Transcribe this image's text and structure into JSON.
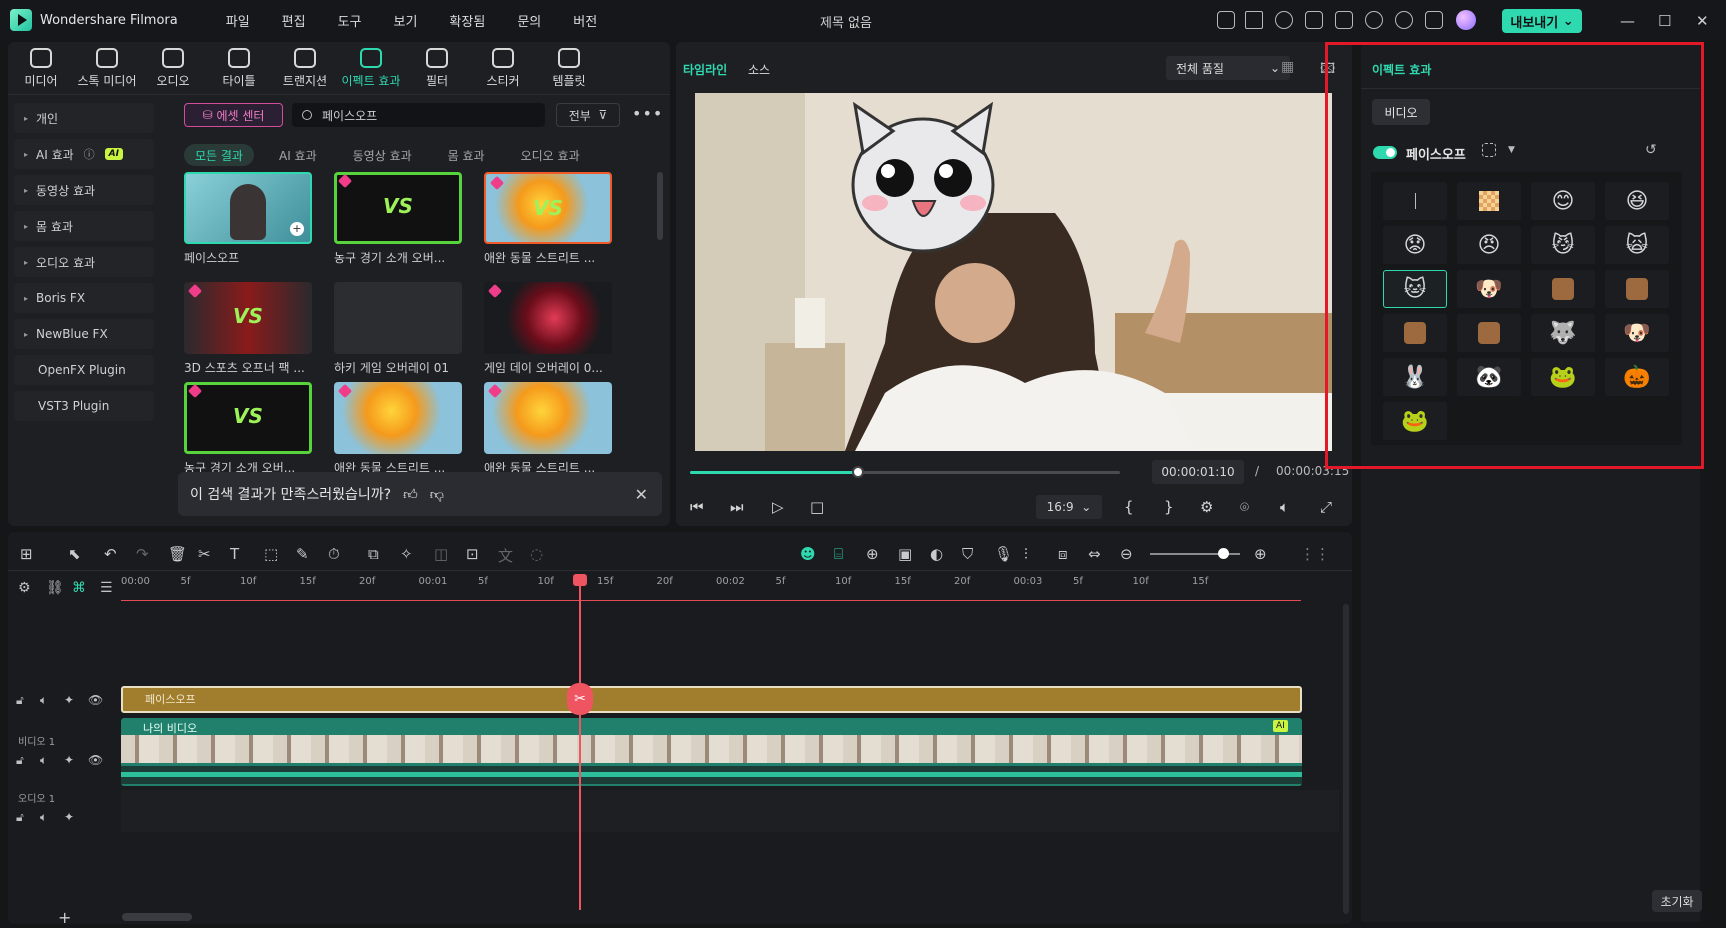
{
  "app": {
    "name": "Wondershare Filmora",
    "doc_title": "제목 없음",
    "export_label": "내보내기"
  },
  "menu": [
    "파일",
    "편집",
    "도구",
    "보기",
    "확장됨",
    "문의",
    "버전"
  ],
  "media_toolbar": [
    {
      "label": "미디어",
      "active": false
    },
    {
      "label": "스톡 미디어",
      "active": false
    },
    {
      "label": "오디오",
      "active": false
    },
    {
      "label": "타이틀",
      "active": false
    },
    {
      "label": "트랜지션",
      "active": false
    },
    {
      "label": "이펙트 효과",
      "active": true
    },
    {
      "label": "필터",
      "active": false
    },
    {
      "label": "스티커",
      "active": false
    },
    {
      "label": "템플릿",
      "active": false
    }
  ],
  "categories": [
    {
      "label": "개인",
      "arrow": true
    },
    {
      "label": "AI 효과",
      "arrow": true,
      "badge": "AI"
    },
    {
      "label": "동영상 효과",
      "arrow": true
    },
    {
      "label": "몸 효과",
      "arrow": true
    },
    {
      "label": "오디오 효과",
      "arrow": true
    },
    {
      "label": "Boris FX",
      "arrow": true
    },
    {
      "label": "NewBlue FX",
      "arrow": true
    },
    {
      "label": "OpenFX Plugin",
      "arrow": false
    },
    {
      "label": "VST3 Plugin",
      "arrow": false
    }
  ],
  "asset_center": "에셋 센터",
  "search": {
    "value": "페이스오프"
  },
  "filter_all": "전부",
  "subtabs": [
    "모든 결과",
    "AI 효과",
    "동영상 효과",
    "몸 효과",
    "오디오 효과"
  ],
  "cards": [
    {
      "caption": "페이스오프",
      "kind": "face"
    },
    {
      "caption": "농구 경기 소개 오버...",
      "kind": "vs"
    },
    {
      "caption": "애완 동물 스트리트 ...",
      "kind": "flower-vs"
    },
    {
      "caption": "3D 스포츠 오프너 팩 ...",
      "kind": "red-vs"
    },
    {
      "caption": "하키 게임 오버레이 01",
      "kind": "dark"
    },
    {
      "caption": "게임 데이 오버레이 0...",
      "kind": "eye"
    },
    {
      "caption": "농구 경기 소개 오버...",
      "kind": "vs"
    },
    {
      "caption": "애완 동물 스트리트 ...",
      "kind": "flower"
    },
    {
      "caption": "애완 동물 스트리트 ...",
      "kind": "flower"
    }
  ],
  "feedback": "이 검색 결과가 만족스러웠습니까?",
  "player": {
    "tab_timeline": "타임라인",
    "tab_source": "소스",
    "quality": "전체 품질",
    "timecode_current": "00:00:01:10",
    "timecode_sep": "/",
    "timecode_total": "00:00:03:15",
    "ratio": "16:9",
    "progress": 0.38
  },
  "effect_panel": {
    "title": "이펙트 효과",
    "tab": "비디오",
    "effect_name": "페이스오프",
    "reset": "초기화",
    "faces": [
      "none",
      "mosaic",
      "😊",
      "😆",
      "😟",
      "😠",
      "😼",
      "🙀",
      "🐱",
      "🐶",
      "🟫",
      "🟫",
      "🟫",
      "🟫",
      "🐺",
      "🐶",
      "🐰",
      "🐼",
      "🐸",
      "🎃",
      "🐸"
    ]
  },
  "timeline": {
    "ruler": [
      "00:00",
      "5f",
      "10f",
      "15f",
      "20f",
      "00:01",
      "5f",
      "10f",
      "15f",
      "20f",
      "00:02",
      "5f",
      "10f",
      "15f",
      "20f",
      "00:03",
      "5f",
      "10f",
      "15f"
    ],
    "track_video_label": "비디오 1",
    "track_audio_label": "오디오 1",
    "clip_fx_label": "페이스오프",
    "clip_video_label": "나의 비디오",
    "ai_tag": "AI",
    "playhead_fraction": 0.388
  },
  "colors": {
    "accent": "#2fd9b0",
    "playhead": "#ef5561",
    "fx_clip": "#a17e2e",
    "video_clip": "#20806b",
    "highlight_box": "#e3192a"
  }
}
